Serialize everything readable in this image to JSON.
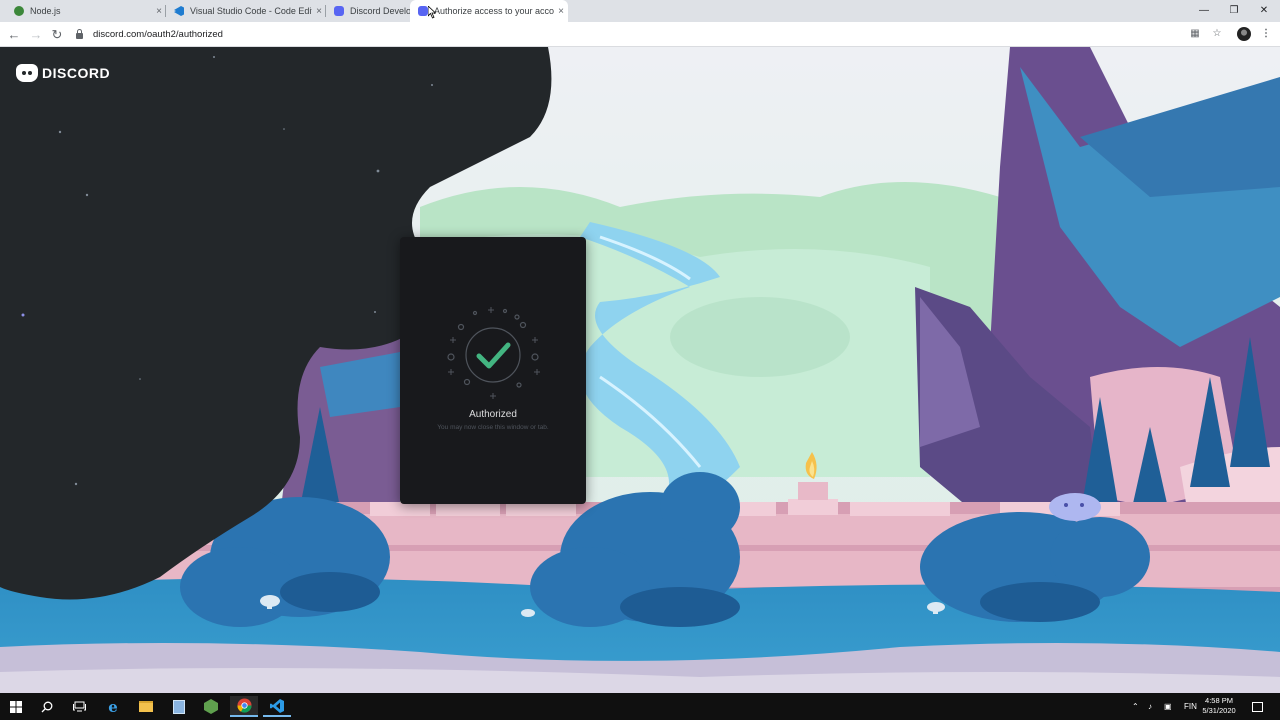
{
  "browser": {
    "tabs": [
      {
        "title": "Node.js",
        "icon": "nodejs-icon",
        "active": false
      },
      {
        "title": "Visual Studio Code - Code Editing. Redefined",
        "icon": "vscode-icon",
        "active": false
      },
      {
        "title": "Discord Developer Portal",
        "icon": "discord-icon",
        "active": false
      },
      {
        "title": "Authorize access to your account",
        "icon": "discord-icon",
        "active": true
      }
    ],
    "address": "discord.com/oauth2/authorized",
    "close_glyph": "×"
  },
  "page": {
    "logo_text": "DISCORD",
    "auth": {
      "title": "Authorized",
      "subtitle": "You may now close this window or tab."
    }
  },
  "taskbar": {
    "language": "FIN",
    "time": "4:58 PM",
    "date": "5/31/2020"
  },
  "colors": {
    "accent_check": "#43b581",
    "card_bg": "#18191c",
    "dark_blob": "#23272a"
  }
}
